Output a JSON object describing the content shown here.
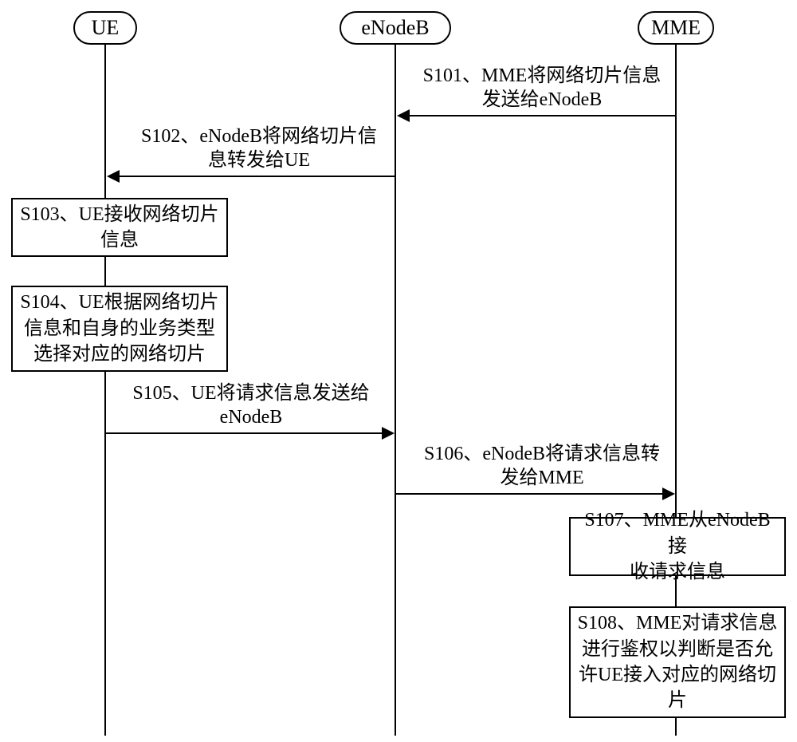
{
  "actors": {
    "ue": "UE",
    "enodeb": "eNodeB",
    "mme": "MME"
  },
  "messages": {
    "s101": "S101、MME将网络切片信息\n发送给eNodeB",
    "s102": "S102、eNodeB将网络切片信\n息转发给UE",
    "s105": "S105、UE将请求信息发送给\neNodeB",
    "s106": "S106、eNodeB将请求信息转\n发给MME"
  },
  "steps": {
    "s103": "S103、UE接收网络切片\n信息",
    "s104": "S104、UE根据网络切片\n信息和自身的业务类型\n选择对应的网络切片",
    "s107": "S107、MME从eNodeB接\n收请求信息",
    "s108": "S108、MME对请求信息\n进行鉴权以判断是否允\n许UE接入对应的网络切\n片"
  }
}
